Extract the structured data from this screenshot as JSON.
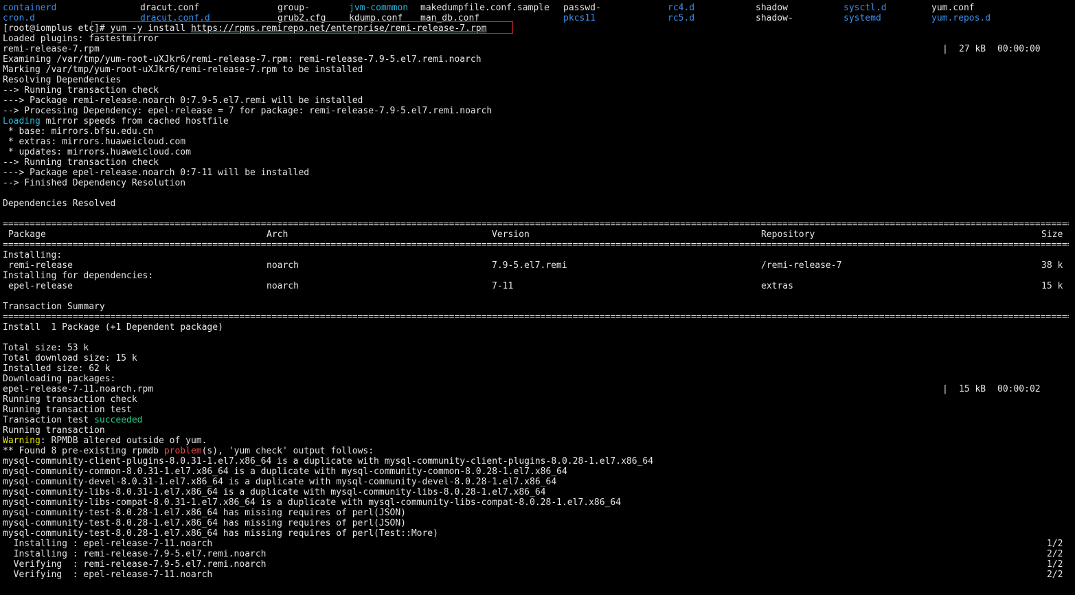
{
  "listing": {
    "row1": [
      "containerd",
      "dracut.conf",
      "group-",
      "jvm-commmon",
      "makedumpfile.conf.sample",
      "passwd-",
      "rc4.d",
      "shadow",
      "sysctl.d",
      "yum.conf"
    ],
    "row2": [
      "cron.d",
      "dracut.conf.d",
      "grub2.cfg",
      "kdump.conf",
      "man_db.conf",
      "pkcs11",
      "rc5.d",
      "shadow-",
      "systemd",
      "yum.repos.d"
    ]
  },
  "prompt": {
    "user_host": "[root@iomplus etc]# ",
    "command": "yum -y install ",
    "url": "https://rpms.remirepo.net/enterprise/remi-release-7.rpm"
  },
  "log_a": [
    "Loaded plugins: fastestmirror",
    "remi-release-7.rpm",
    "Examining /var/tmp/yum-root-uXJkr6/remi-release-7.rpm: remi-release-7.9-5.el7.remi.noarch",
    "Marking /var/tmp/yum-root-uXJkr6/remi-release-7.rpm to be installed",
    "Resolving Dependencies",
    "--> Running transaction check",
    "---> Package remi-release.noarch 0:7.9-5.el7.remi will be installed",
    "--> Processing Dependency: epel-release = 7 for package: remi-release-7.9-5.el7.remi.noarch"
  ],
  "download1": {
    "bar": "|",
    "size": "27 kB",
    "time": "00:00:00"
  },
  "loading": {
    "word": "Loading",
    "rest": " mirror speeds from cached hostfile"
  },
  "log_b": [
    " * base: mirrors.bfsu.edu.cn",
    " * extras: mirrors.huaweicloud.com",
    " * updates: mirrors.huaweicloud.com",
    "--> Running transaction check",
    "---> Package epel-release.noarch 0:7-11 will be installed",
    "--> Finished Dependency Resolution",
    "",
    "Dependencies Resolved"
  ],
  "table": {
    "headers": {
      "package": "Package",
      "arch": "Arch",
      "version": "Version",
      "repository": "Repository",
      "size": "Size"
    },
    "installing_label": "Installing:",
    "deps_label": "Installing for dependencies:",
    "rows": [
      {
        "package": "remi-release",
        "arch": "noarch",
        "version": "7.9-5.el7.remi",
        "repository": "/remi-release-7",
        "size": "38 k"
      },
      {
        "package": "epel-release",
        "arch": "noarch",
        "version": "7-11",
        "repository": "extras",
        "size": "15 k"
      }
    ],
    "summary_title": "Transaction Summary",
    "summary_line": "Install  1 Package (+1 Dependent package)"
  },
  "log_c": [
    "Total size: 53 k",
    "Total download size: 15 k",
    "Installed size: 62 k",
    "Downloading packages:",
    "epel-release-7-11.noarch.rpm",
    "Running transaction check",
    "Running transaction test"
  ],
  "download2": {
    "bar": "|",
    "size": "15 kB",
    "time": "00:00:02"
  },
  "test_result": {
    "prefix": "Transaction test ",
    "status": "succeeded"
  },
  "running": "Running transaction",
  "warning": {
    "label": "Warning",
    "rest": ": RPMDB altered outside of yum."
  },
  "found": {
    "prefix": "** Found 8 pre-existing rpmdb ",
    "word": "problem",
    "suffix": "(s), 'yum check' output follows:"
  },
  "problems": [
    "mysql-community-client-plugins-8.0.31-1.el7.x86_64 is a duplicate with mysql-community-client-plugins-8.0.28-1.el7.x86_64",
    "mysql-community-common-8.0.31-1.el7.x86_64 is a duplicate with mysql-community-common-8.0.28-1.el7.x86_64",
    "mysql-community-devel-8.0.31-1.el7.x86_64 is a duplicate with mysql-community-devel-8.0.28-1.el7.x86_64",
    "mysql-community-libs-8.0.31-1.el7.x86_64 is a duplicate with mysql-community-libs-8.0.28-1.el7.x86_64",
    "mysql-community-libs-compat-8.0.31-1.el7.x86_64 is a duplicate with mysql-community-libs-compat-8.0.28-1.el7.x86_64",
    "mysql-community-test-8.0.28-1.el7.x86_64 has missing requires of perl(JSON)",
    "mysql-community-test-8.0.28-1.el7.x86_64 has missing requires of perl(JSON)",
    "mysql-community-test-8.0.28-1.el7.x86_64 has missing requires of perl(Test::More)"
  ],
  "steps": [
    {
      "text": "  Installing : epel-release-7-11.noarch",
      "count": "1/2"
    },
    {
      "text": "  Installing : remi-release-7.9-5.el7.remi.noarch",
      "count": "2/2"
    },
    {
      "text": "  Verifying  : remi-release-7.9-5.el7.remi.noarch",
      "count": "1/2"
    },
    {
      "text": "  Verifying  : epel-release-7-11.noarch",
      "count": "2/2"
    }
  ],
  "colors": {
    "background": "#000000",
    "text": "#e6e6e6",
    "directory": "#3b8eea",
    "link": "#29b8db",
    "success": "#23d18b",
    "warning": "#e5e510",
    "error": "#f14c4c",
    "highlight_box": "#e0242b"
  }
}
